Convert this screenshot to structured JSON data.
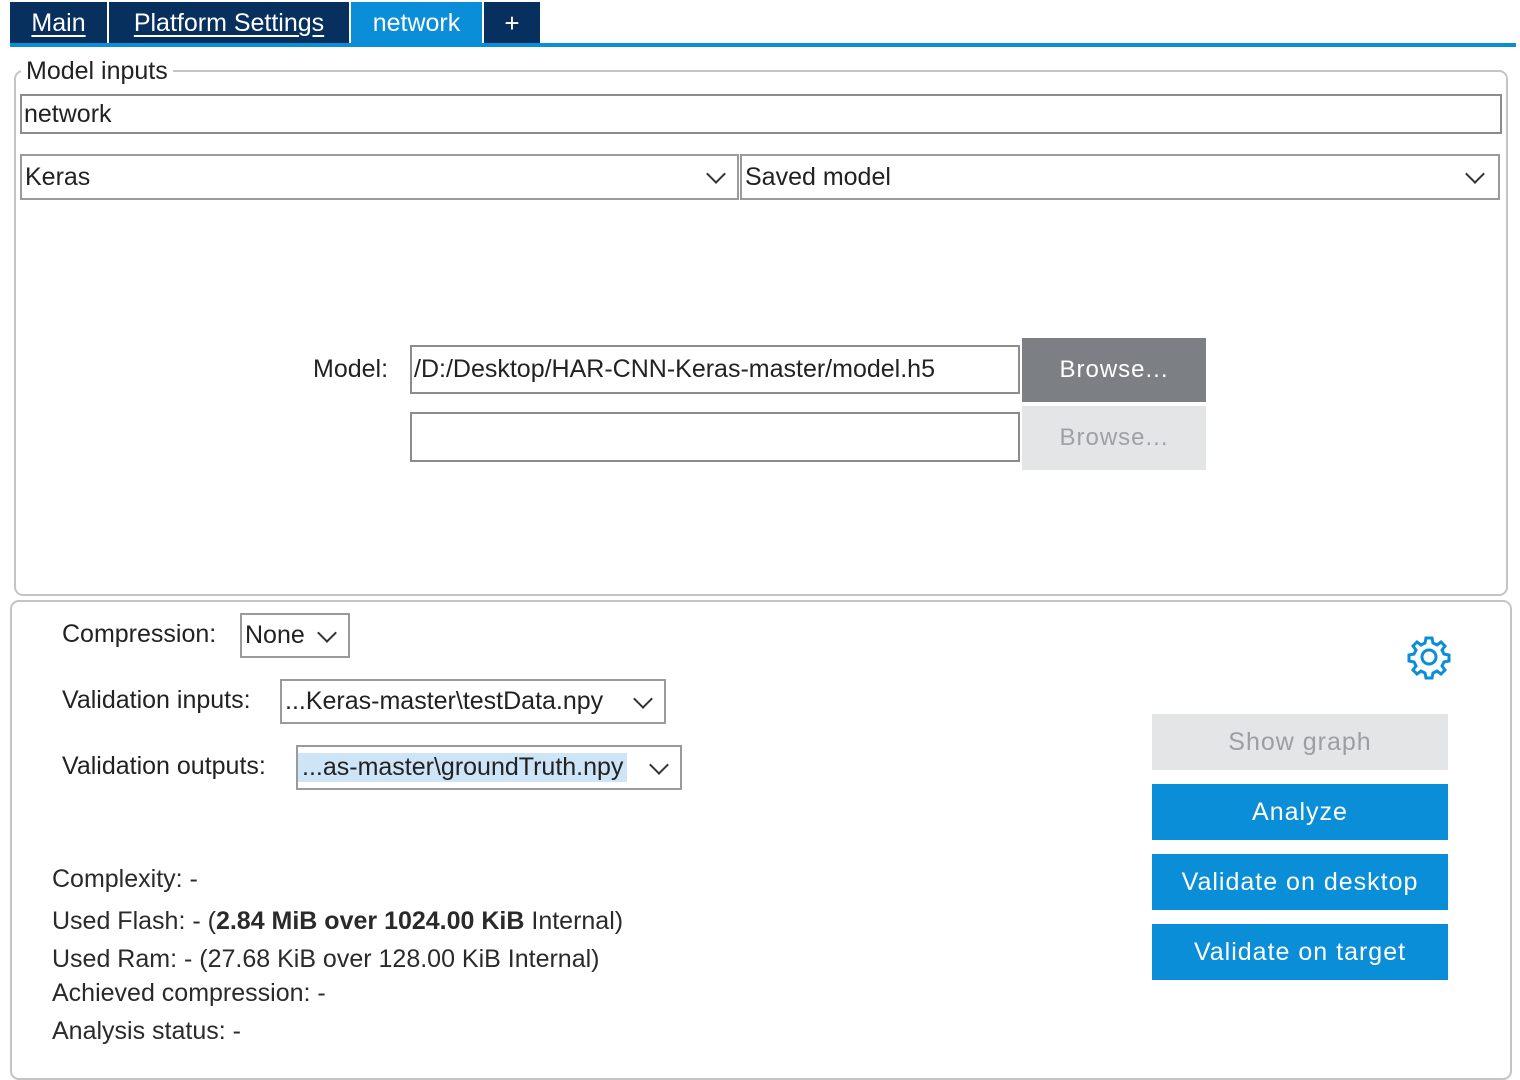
{
  "tabs": [
    {
      "label": "Main"
    },
    {
      "label": "Platform Settings"
    },
    {
      "label": "network"
    },
    {
      "label": "+"
    }
  ],
  "model_inputs": {
    "legend": "Model inputs",
    "network_name": "network",
    "framework": "Keras",
    "model_type": "Saved model",
    "model_label": "Model:",
    "model_path": "/D:/Desktop/HAR-CNN-Keras-master/model.h5",
    "model_path2": "",
    "browse_label": "Browse...",
    "browse2_label": "Browse..."
  },
  "settings": {
    "compression_label": "Compression:",
    "compression_value": "None",
    "validation_inputs_label": "Validation inputs:",
    "validation_inputs_value": "...Keras-master\\testData.npy",
    "validation_outputs_label": "Validation outputs:",
    "validation_outputs_value": "...as-master\\groundTruth.npy"
  },
  "stats": {
    "complexity": "Complexity: -",
    "flash_prefix": "Used Flash: - (",
    "flash_bold": "2.84 MiB over 1024.00 KiB",
    "flash_suffix": " Internal)",
    "ram": "Used Ram: - (27.68 KiB over 128.00 KiB Internal)",
    "achieved_compression": "Achieved compression: -",
    "analysis_status": "Analysis status: -"
  },
  "actions": {
    "show_graph": "Show graph",
    "analyze": "Analyze",
    "validate_desktop": "Validate on desktop",
    "validate_target": "Validate on target"
  },
  "icons": {
    "settings": "gear-icon"
  },
  "colors": {
    "tab_dark": "#08305f",
    "accent_blue": "#0b8ed8",
    "browse_gray": "#7c7f83",
    "disabled_bg": "#e3e5e7",
    "selection_highlight": "#cde5f7"
  }
}
